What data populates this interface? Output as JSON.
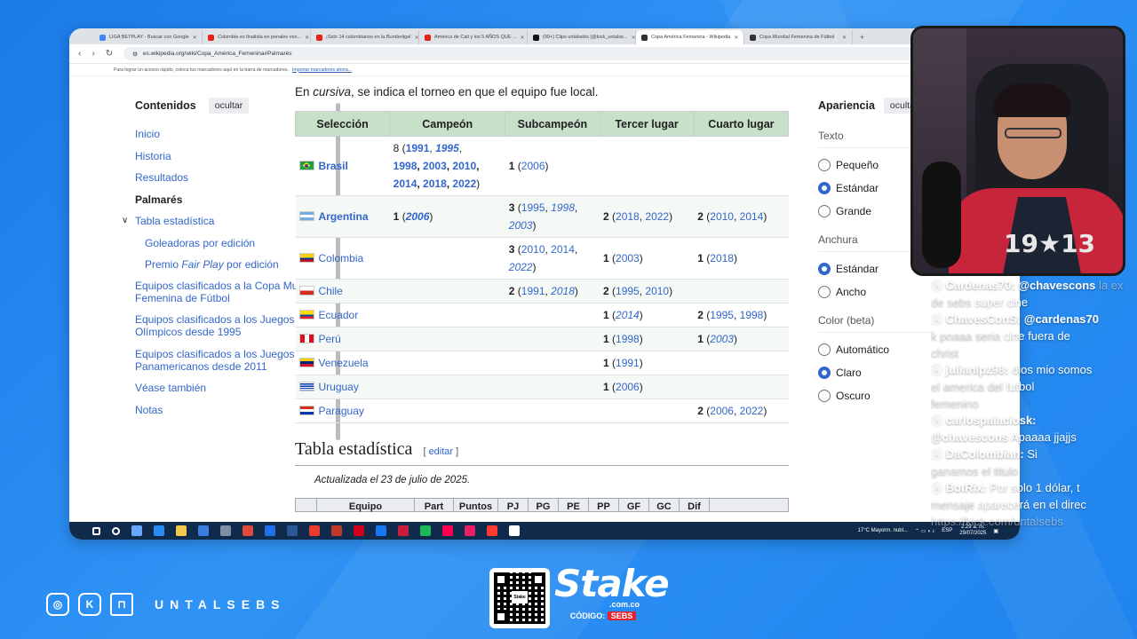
{
  "browser": {
    "tabs": [
      {
        "label": "LIGA BETPLAY - Buscar con Google",
        "color": "#4285f4"
      },
      {
        "label": "Colombia es finalista en penales ven...",
        "color": "#e62117"
      },
      {
        "label": "¡Solo 14 colombianos en la Bunderliga!",
        "color": "#e62117"
      },
      {
        "label": "América de Cali y los 5 AÑOS QUE ...",
        "color": "#e62117"
      },
      {
        "label": "(99+) Clips untalsebs (@kick_untalse...",
        "color": "#111111"
      },
      {
        "label": "Copa América Femenina - Wikipedia",
        "color": "#333333",
        "active": true
      },
      {
        "label": "Copa Mundial Femenina de Fútbol",
        "color": "#333333"
      }
    ],
    "new_tab": "+",
    "url": "es.wikipedia.org/wiki/Copa_América_Femenina#Palmarés",
    "bookmark_text": "Para lograr un acceso rápido, coloca tus marcadores aquí en la barra de marcadores.",
    "bookmark_link": "Importar marcadores ahora..."
  },
  "toc": {
    "title": "Contenidos",
    "hide": "ocultar",
    "items": [
      {
        "label": "Inicio",
        "type": "link"
      },
      {
        "label": "Historia",
        "type": "link"
      },
      {
        "label": "Resultados",
        "type": "link"
      },
      {
        "label": "Palmarés",
        "type": "current"
      },
      {
        "label": "Tabla estadística",
        "type": "chev"
      },
      {
        "label": "Goleadoras por edición",
        "type": "sub"
      },
      {
        "label": "Premio Fair Play por edición",
        "type": "sub"
      },
      {
        "label": "Equipos clasificados a la Copa Mundial Femenina de Fútbol",
        "type": "link"
      },
      {
        "label": "Equipos clasificados a los Juegos Olímpicos desde 1995",
        "type": "link"
      },
      {
        "label": "Equipos clasificados a los Juegos Panamericanos desde 2011",
        "type": "link"
      },
      {
        "label": "Véase también",
        "type": "link"
      },
      {
        "label": "Notas",
        "type": "link"
      }
    ]
  },
  "content": {
    "intro_pre": "En ",
    "intro_em": "cursiva",
    "intro_post": ", se indica el torneo en que el equipo fue local.",
    "table_headers": [
      "Selección",
      "Campeón",
      "Subcampeón",
      "Tercer lugar",
      "Cuarto lugar"
    ],
    "rows": [
      {
        "team": "Brasil",
        "flag": "brasil",
        "bold": true,
        "c1": "8 (<b><a>1991</a></b>, <b><i><a>1995</a></i></b>,<br><b><a>1998</a>, <a>2003</a>, <a>2010</a>,</b><br><b><a>2014</a>, <a>2018</a>, <a>2022</a></b>)",
        "c2": "<b>1</b> (<a>2006</a>)",
        "c3": "",
        "c4": ""
      },
      {
        "team": "Argentina",
        "flag": "argentina",
        "bold": true,
        "c1": "<b>1</b> (<b><i><a>2006</a></i></b>)",
        "c2": "<b>3</b> (<a>1995</a>, <i><a>1998</a></i>,<br><i><a>2003</a></i>)",
        "c3": "<b>2</b> (<a>2018</a>, <a>2022</a>)",
        "c4": "<b>2</b> (<a>2010</a>, <a>2014</a>)"
      },
      {
        "team": "Colombia",
        "flag": "colombia",
        "bold": false,
        "c1": "",
        "c2": "<b>3</b> (<a>2010</a>, <a>2014</a>,<br><i><a>2022</a></i>)",
        "c3": "<b>1</b> (<a>2003</a>)",
        "c4": "<b>1</b> (<a>2018</a>)"
      },
      {
        "team": "Chile",
        "flag": "chile",
        "bold": false,
        "c1": "",
        "c2": "<b>2</b> (<a>1991</a>, <i><a>2018</a></i>)",
        "c3": "<b>2</b> (<a>1995</a>, <a>2010</a>)",
        "c4": ""
      },
      {
        "team": "Ecuador",
        "flag": "ecuador",
        "bold": false,
        "c1": "",
        "c2": "",
        "c3": "<b>1</b> (<i><a>2014</a></i>)",
        "c4": "<b>2</b> (<a>1995</a>, <a>1998</a>)"
      },
      {
        "team": "Perú",
        "flag": "peru",
        "bold": false,
        "c1": "",
        "c2": "",
        "c3": "<b>1</b> (<a>1998</a>)",
        "c4": "<b>1</b> (<i><a>2003</a></i>)"
      },
      {
        "team": "Venezuela",
        "flag": "venezuela",
        "bold": false,
        "c1": "",
        "c2": "",
        "c3": "<b>1</b> (<a>1991</a>)",
        "c4": ""
      },
      {
        "team": "Uruguay",
        "flag": "uruguay",
        "bold": false,
        "c1": "",
        "c2": "",
        "c3": "<b>1</b> (<a>2006</a>)",
        "c4": ""
      },
      {
        "team": "Paraguay",
        "flag": "paraguay",
        "bold": false,
        "c1": "",
        "c2": "",
        "c3": "",
        "c4": "<b>2</b> (<a>2006</a>, <a>2022</a>)"
      }
    ],
    "section_title": "Tabla estadística",
    "edit_open": "[ ",
    "edit_label": "editar",
    "edit_close": " ]",
    "updated": "Actualizada el 23 de julio de 2025.",
    "stats_headers": [
      "",
      "Equipo",
      "Part",
      "Puntos",
      "PJ",
      "PG",
      "PE",
      "PP",
      "GF",
      "GC",
      "Dif"
    ]
  },
  "appearance": {
    "title": "Apariencia",
    "hide": "ocultar",
    "sections": [
      {
        "label": "Texto",
        "options": [
          {
            "label": "Pequeño",
            "on": false
          },
          {
            "label": "Estándar",
            "on": true
          },
          {
            "label": "Grande",
            "on": false
          }
        ]
      },
      {
        "label": "Anchura",
        "options": [
          {
            "label": "Estándar",
            "on": true
          },
          {
            "label": "Ancho",
            "on": false
          }
        ]
      },
      {
        "label": "Color (beta)",
        "options": [
          {
            "label": "Automático",
            "on": false
          },
          {
            "label": "Claro",
            "on": true
          },
          {
            "label": "Oscuro",
            "on": false
          }
        ]
      }
    ]
  },
  "taskbar": {
    "weather": "17°C  Mayorm. nubl...",
    "lang": "ESP",
    "time": "2:29 a. m.",
    "date": "29/07/2025",
    "icon_colors": [
      "#ffffff",
      "#ffffff",
      "#6aa7ff",
      "#2a8bf2",
      "#f2c94c",
      "#3b7ddd",
      "#7f8ea3",
      "#e04a3a",
      "#1f6feb",
      "#2b5797",
      "#e63b2e",
      "#c0392b",
      "#d0021b",
      "#1877f2",
      "#c81e3c",
      "#1db954",
      "#ff0050",
      "#e91e63",
      "#ff3b30",
      "#ffffff"
    ]
  },
  "cam": {
    "shirt_number": "19★13"
  },
  "chat": [
    {
      "user": "Cardenas70:",
      "text": " @chavescons",
      "faded": " la ex de sebs",
      "tail": " super cine",
      "mention": true
    },
    {
      "user": "ChavesConS:",
      "text": " @cardenas70",
      "faded": "",
      "tail": " ",
      "mention": true
    },
    {
      "user": "",
      "text": "",
      "faded": "k poaaa seria",
      "tail": " cine fuera de",
      "mention": false
    },
    {
      "user": "",
      "text": "",
      "faded": "christ",
      "tail": "",
      "mention": false
    },
    {
      "user": "julianlpz98:",
      "text": " dios mio somos",
      "faded": "",
      "tail": "",
      "mention": false
    },
    {
      "user": "",
      "text": "",
      "faded": "el america del",
      "tail": " futbol",
      "mention": false
    },
    {
      "user": "",
      "text": "",
      "faded": "femenino",
      "tail": "",
      "mention": false
    },
    {
      "user": "carlospalaciosk:",
      "text": "",
      "faded": "",
      "tail": "",
      "mention": false
    },
    {
      "user": "",
      "text": "@chavescons",
      "faded": "",
      "tail": " Apaaaa jjajjs",
      "mention": true
    },
    {
      "user": "DaColombian:",
      "text": " Si",
      "faded": "",
      "tail": "",
      "mention": false
    },
    {
      "user": "",
      "text": "",
      "faded": "ganamos el titulo",
      "tail": "",
      "mention": false
    },
    {
      "user": "BotRix:",
      "text": " Por solo 1 dólar, t",
      "faded": "",
      "tail": "",
      "mention": false
    },
    {
      "user": "",
      "text": "",
      "faded": "mensaje",
      "tail": " aparecerá en el direc",
      "mention": false
    },
    {
      "user": "",
      "text": "",
      "faded": "https://kick.com/untalsebs",
      "tail": "",
      "mention": false
    }
  ],
  "footer": {
    "handle": "UNTALSEBS",
    "stake": "Stake",
    "stake_domain": ".com.co",
    "code_label": "CÓDIGO:",
    "code_value": "SEBS",
    "qr_label": "Stake"
  }
}
